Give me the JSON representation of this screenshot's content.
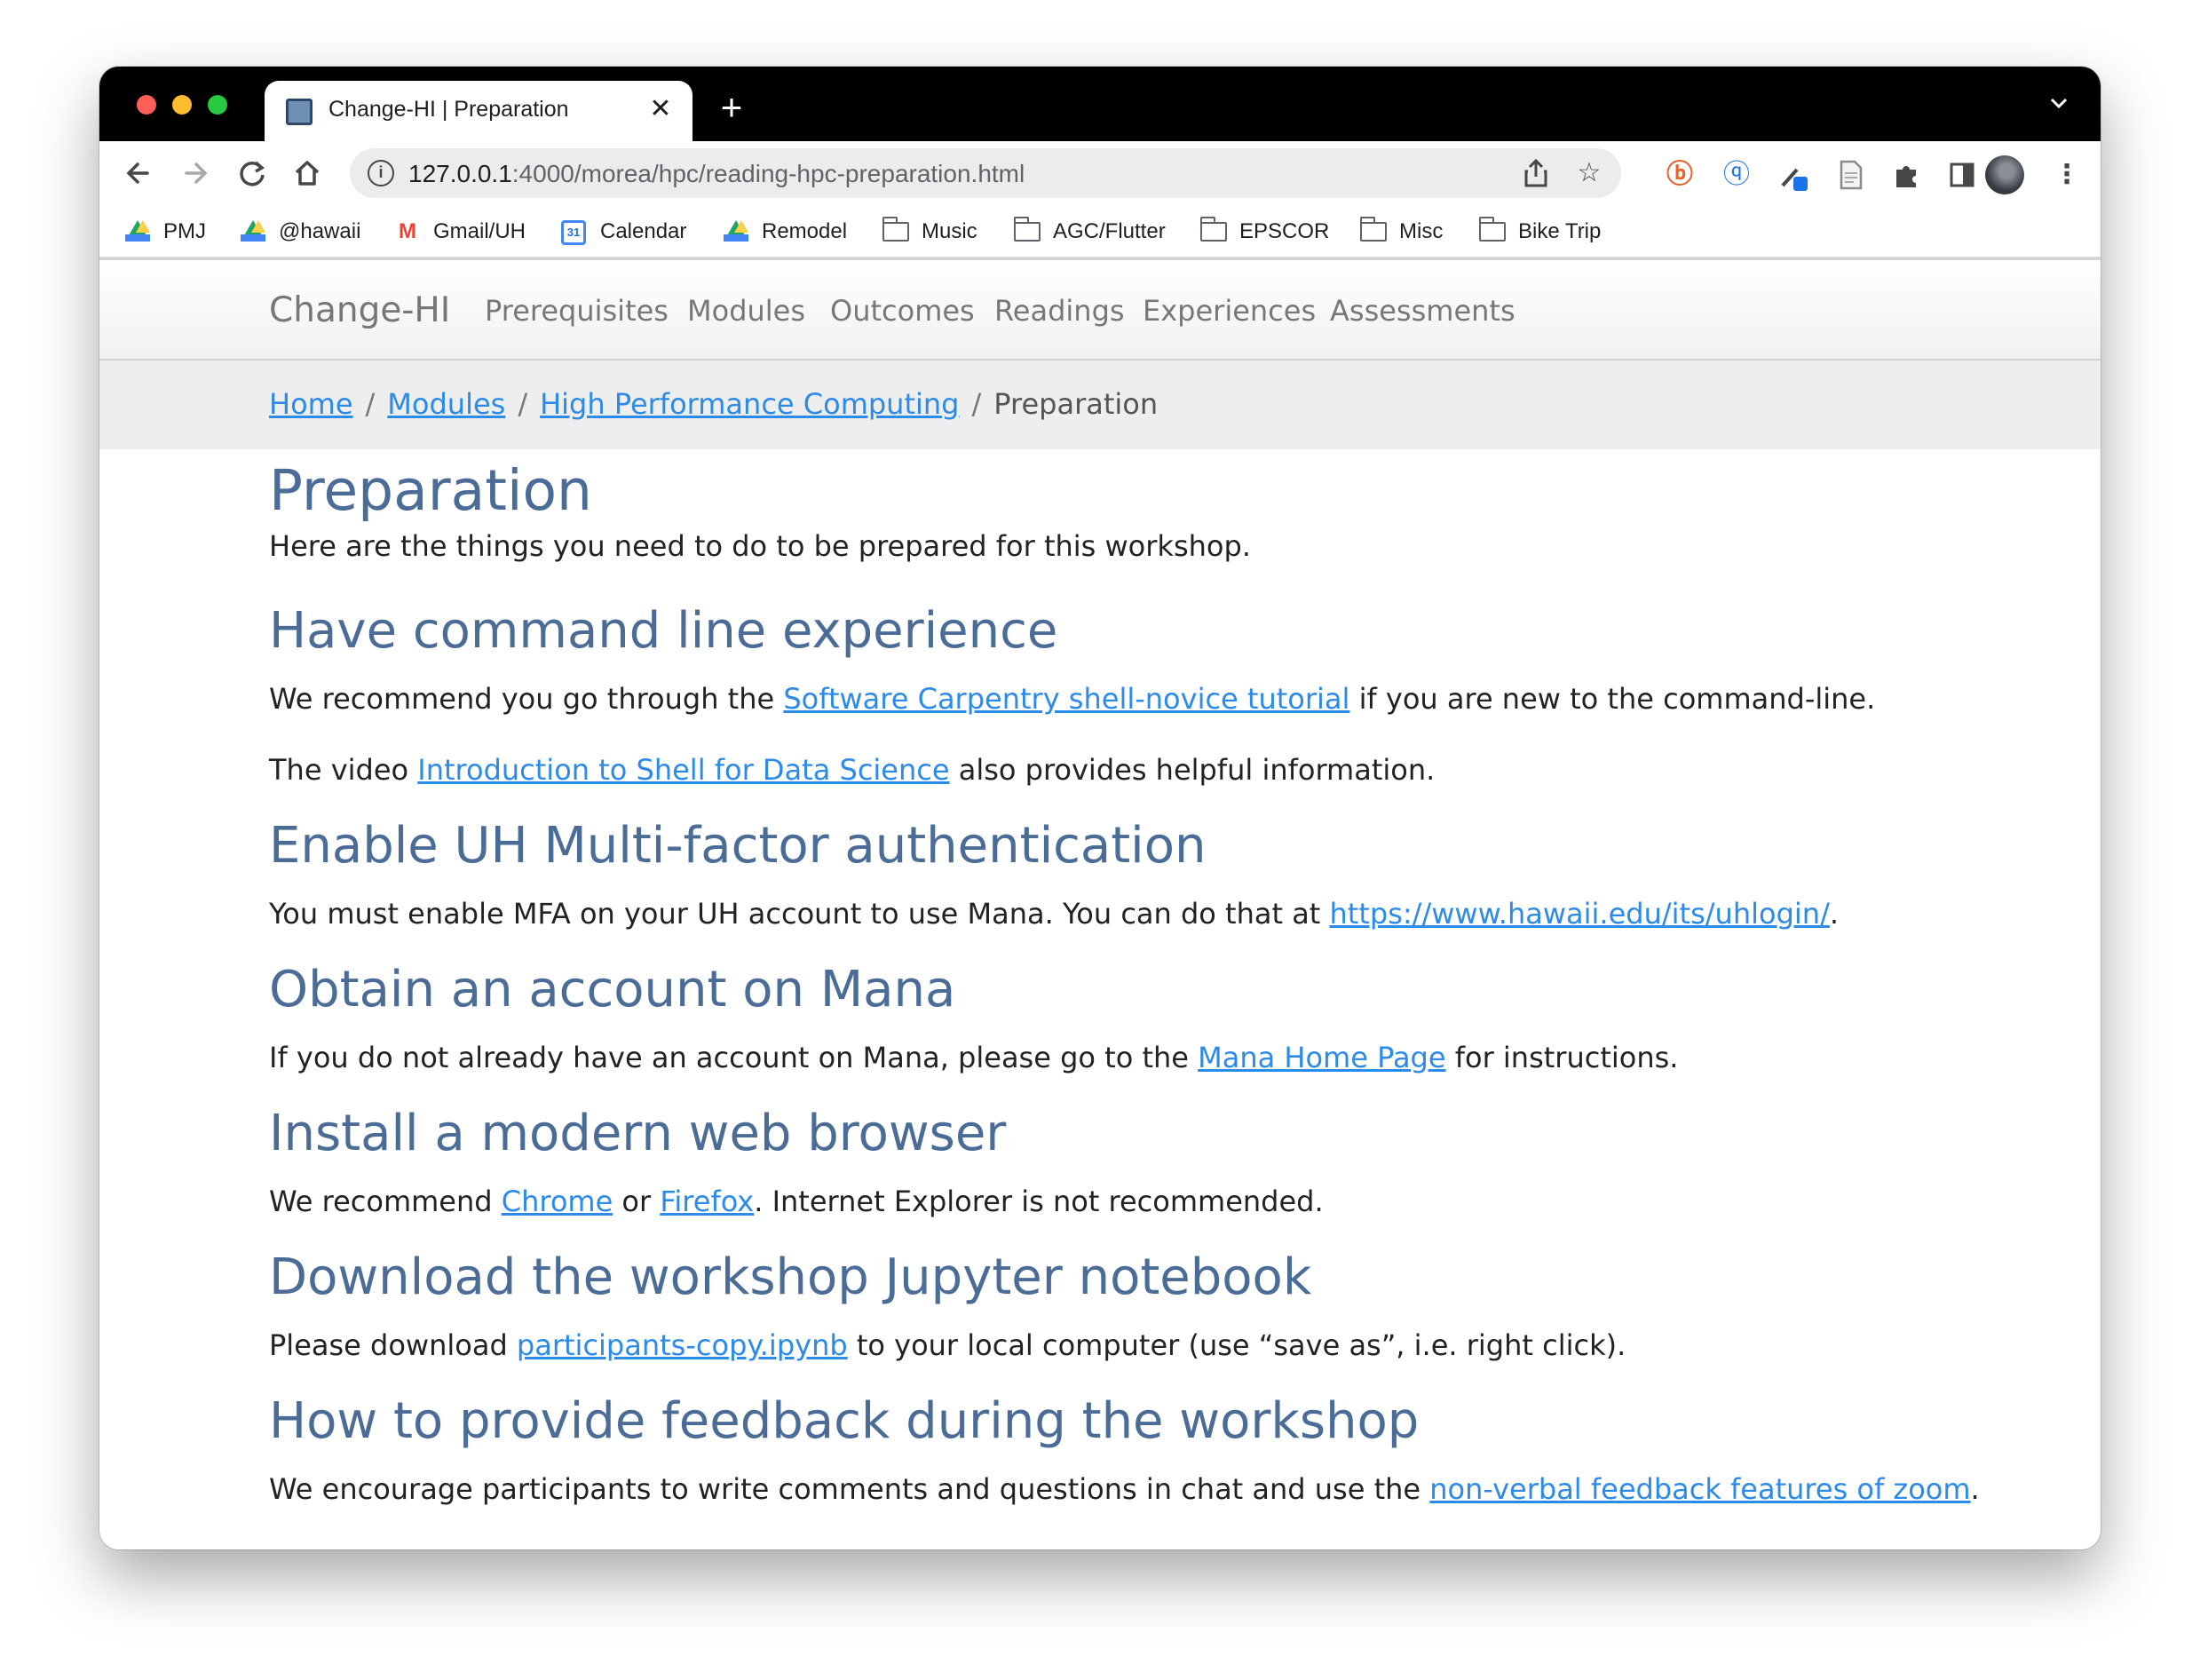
{
  "browser": {
    "tab_title": "Change-HI | Preparation",
    "tab_close": "✕",
    "new_tab": "+",
    "tab_search": "⌄",
    "url_host": "127.0.0.1",
    "url_rest": ":4000/morea/hpc/reading-hpc-preparation.html",
    "bookmarks": [
      "PMJ",
      "@hawaii",
      "Gmail/UH",
      "Calendar",
      "Remodel",
      "Music",
      "AGC/Flutter",
      "EPSCOR",
      "Misc",
      "Bike Trip"
    ],
    "calendar_day": "31"
  },
  "site": {
    "brand": "Change-HI",
    "nav": [
      "Prerequisites",
      "Modules",
      "Outcomes",
      "Readings",
      "Experiences",
      "Assessments"
    ]
  },
  "breadcrumb": {
    "home": "Home",
    "modules": "Modules",
    "module": "High Performance Computing",
    "current": "Preparation",
    "sep": "/"
  },
  "content": {
    "title": "Preparation",
    "intro": "Here are the things you need to do to be prepared for this workshop.",
    "sections": {
      "cli": {
        "heading": "Have command line experience",
        "p1_before": "We recommend you go through the ",
        "p1_link": "Software Carpentry shell-novice tutorial",
        "p1_after": " if you are new to the command-line.",
        "p2_before": "The video ",
        "p2_link": "Introduction to Shell for Data Science",
        "p2_after": " also provides helpful information."
      },
      "mfa": {
        "heading": "Enable UH Multi-factor authentication",
        "before": "You must enable MFA on your UH account to use Mana. You can do that at ",
        "link": "https://www.hawaii.edu/its/uhlogin/",
        "after": "."
      },
      "account": {
        "heading": "Obtain an account on Mana",
        "before": "If you do not already have an account on Mana, please go to the ",
        "link": "Mana Home Page",
        "after": " for instructions."
      },
      "browser": {
        "heading": "Install a modern web browser",
        "before": "We recommend ",
        "link1": "Chrome",
        "mid": " or ",
        "link2": "Firefox",
        "after": ". Internet Explorer is not recommended."
      },
      "notebook": {
        "heading": "Download the workshop Jupyter notebook",
        "before": "Please download ",
        "link": "participants-copy.ipynb",
        "after": " to your local computer (use “save as”, i.e. right click)."
      },
      "feedback": {
        "heading": "How to provide feedback during the workshop",
        "before": "We encourage participants to write comments and questions in chat and use the ",
        "link": "non-verbal feedback features of zoom",
        "after": "."
      }
    }
  },
  "colors": {
    "heading": "#4b6c97",
    "link": "#2c8ae8",
    "nav_text": "#777777",
    "breadcrumb_bg": "#eeeeee"
  }
}
